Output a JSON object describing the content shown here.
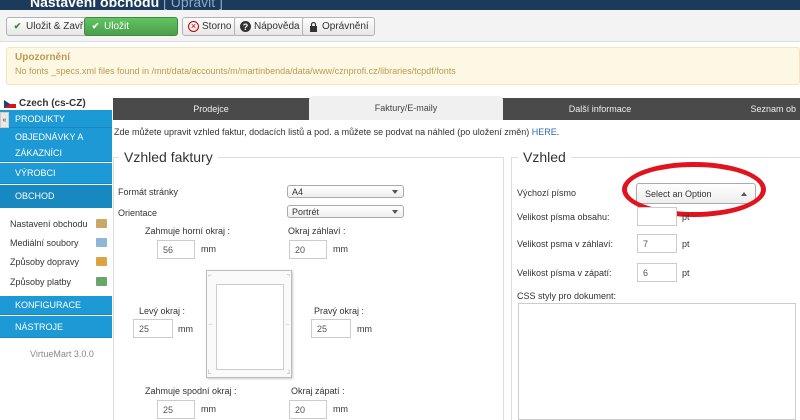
{
  "app": {
    "title": "Nastavení obchodu",
    "subtitle": "[ Upravit ]"
  },
  "toolbar": {
    "save_close": "Uložit & Zavřít",
    "save": "Uložit",
    "cancel": "Storno",
    "help": "Nápověda",
    "permissions": "Oprávnění"
  },
  "notice": {
    "title": "Upozornění",
    "text": "No fonts _specs.xml files found in /mnt/data/accounts/m/martinbenda/data/www/cznprofi.cz/libraries/tcpdf/fonts"
  },
  "language": "Czech (cs-CZ)",
  "sidebar": {
    "sections": [
      "PRODUKTY",
      "OBJEDNÁVKY A ZÁKAZNÍCI",
      "VÝROBCI",
      "OBCHOD"
    ],
    "links": [
      "Nastavení obchodu",
      "Mediální soubory",
      "Způsoby dopravy",
      "Způsoby platby"
    ],
    "sections2": [
      "KONFIGURACE",
      "NÁSTROJE"
    ],
    "version": "VirtueMart 3.0.0"
  },
  "tabs": [
    "Prodejce",
    "Faktury/E-maily",
    "Další informace",
    "Seznam ob"
  ],
  "active_tab": "Faktury/E-maily",
  "intro": {
    "text": "Zde můžete upravit vzhled faktur, dodacích listů a pod. a můžete se podvat na náhled (po uložení změn)",
    "link": "HERE",
    "end": "."
  },
  "left_panel": {
    "title": "Vzhled faktury",
    "page_format_label": "Formát stránky",
    "page_format_value": "A4",
    "orientation_label": "Orientace",
    "orientation_value": "Portrét",
    "top_margin_label": "Zahmuje horní okraj :",
    "top_margin_value": "56",
    "header_margin_label": "Okraj záhlaví :",
    "header_margin_value": "20",
    "left_margin_label": "Levý okraj :",
    "left_margin_value": "25",
    "right_margin_label": "Pravý okraj :",
    "right_margin_value": "25",
    "bottom_margin_label": "Zahmuje spodní okraj :",
    "bottom_margin_value": "25",
    "footer_margin_label": "Okraj zápatí :",
    "footer_margin_value": "20",
    "unit": "mm"
  },
  "right_panel": {
    "title": "Vzhled",
    "default_font_label": "Výchozí písmo",
    "default_font_placeholder": "Select an Option",
    "content_font_size_label": "Velikost písma obsahu:",
    "content_font_size_value": "",
    "header_font_size_label": "Velikost psma v záhlaví:",
    "header_font_size_value": "7",
    "footer_font_size_label": "Velikost písma v zápatí:",
    "footer_font_size_value": "6",
    "css_label": "CSS styly pro dokument:",
    "unit": "pt"
  },
  "colors": {
    "sidebar_blue": "#1d9ad6",
    "tabs_dark": "#4a4a4a",
    "highlight_red": "#e0141e",
    "save_green": "#5cb85c"
  }
}
